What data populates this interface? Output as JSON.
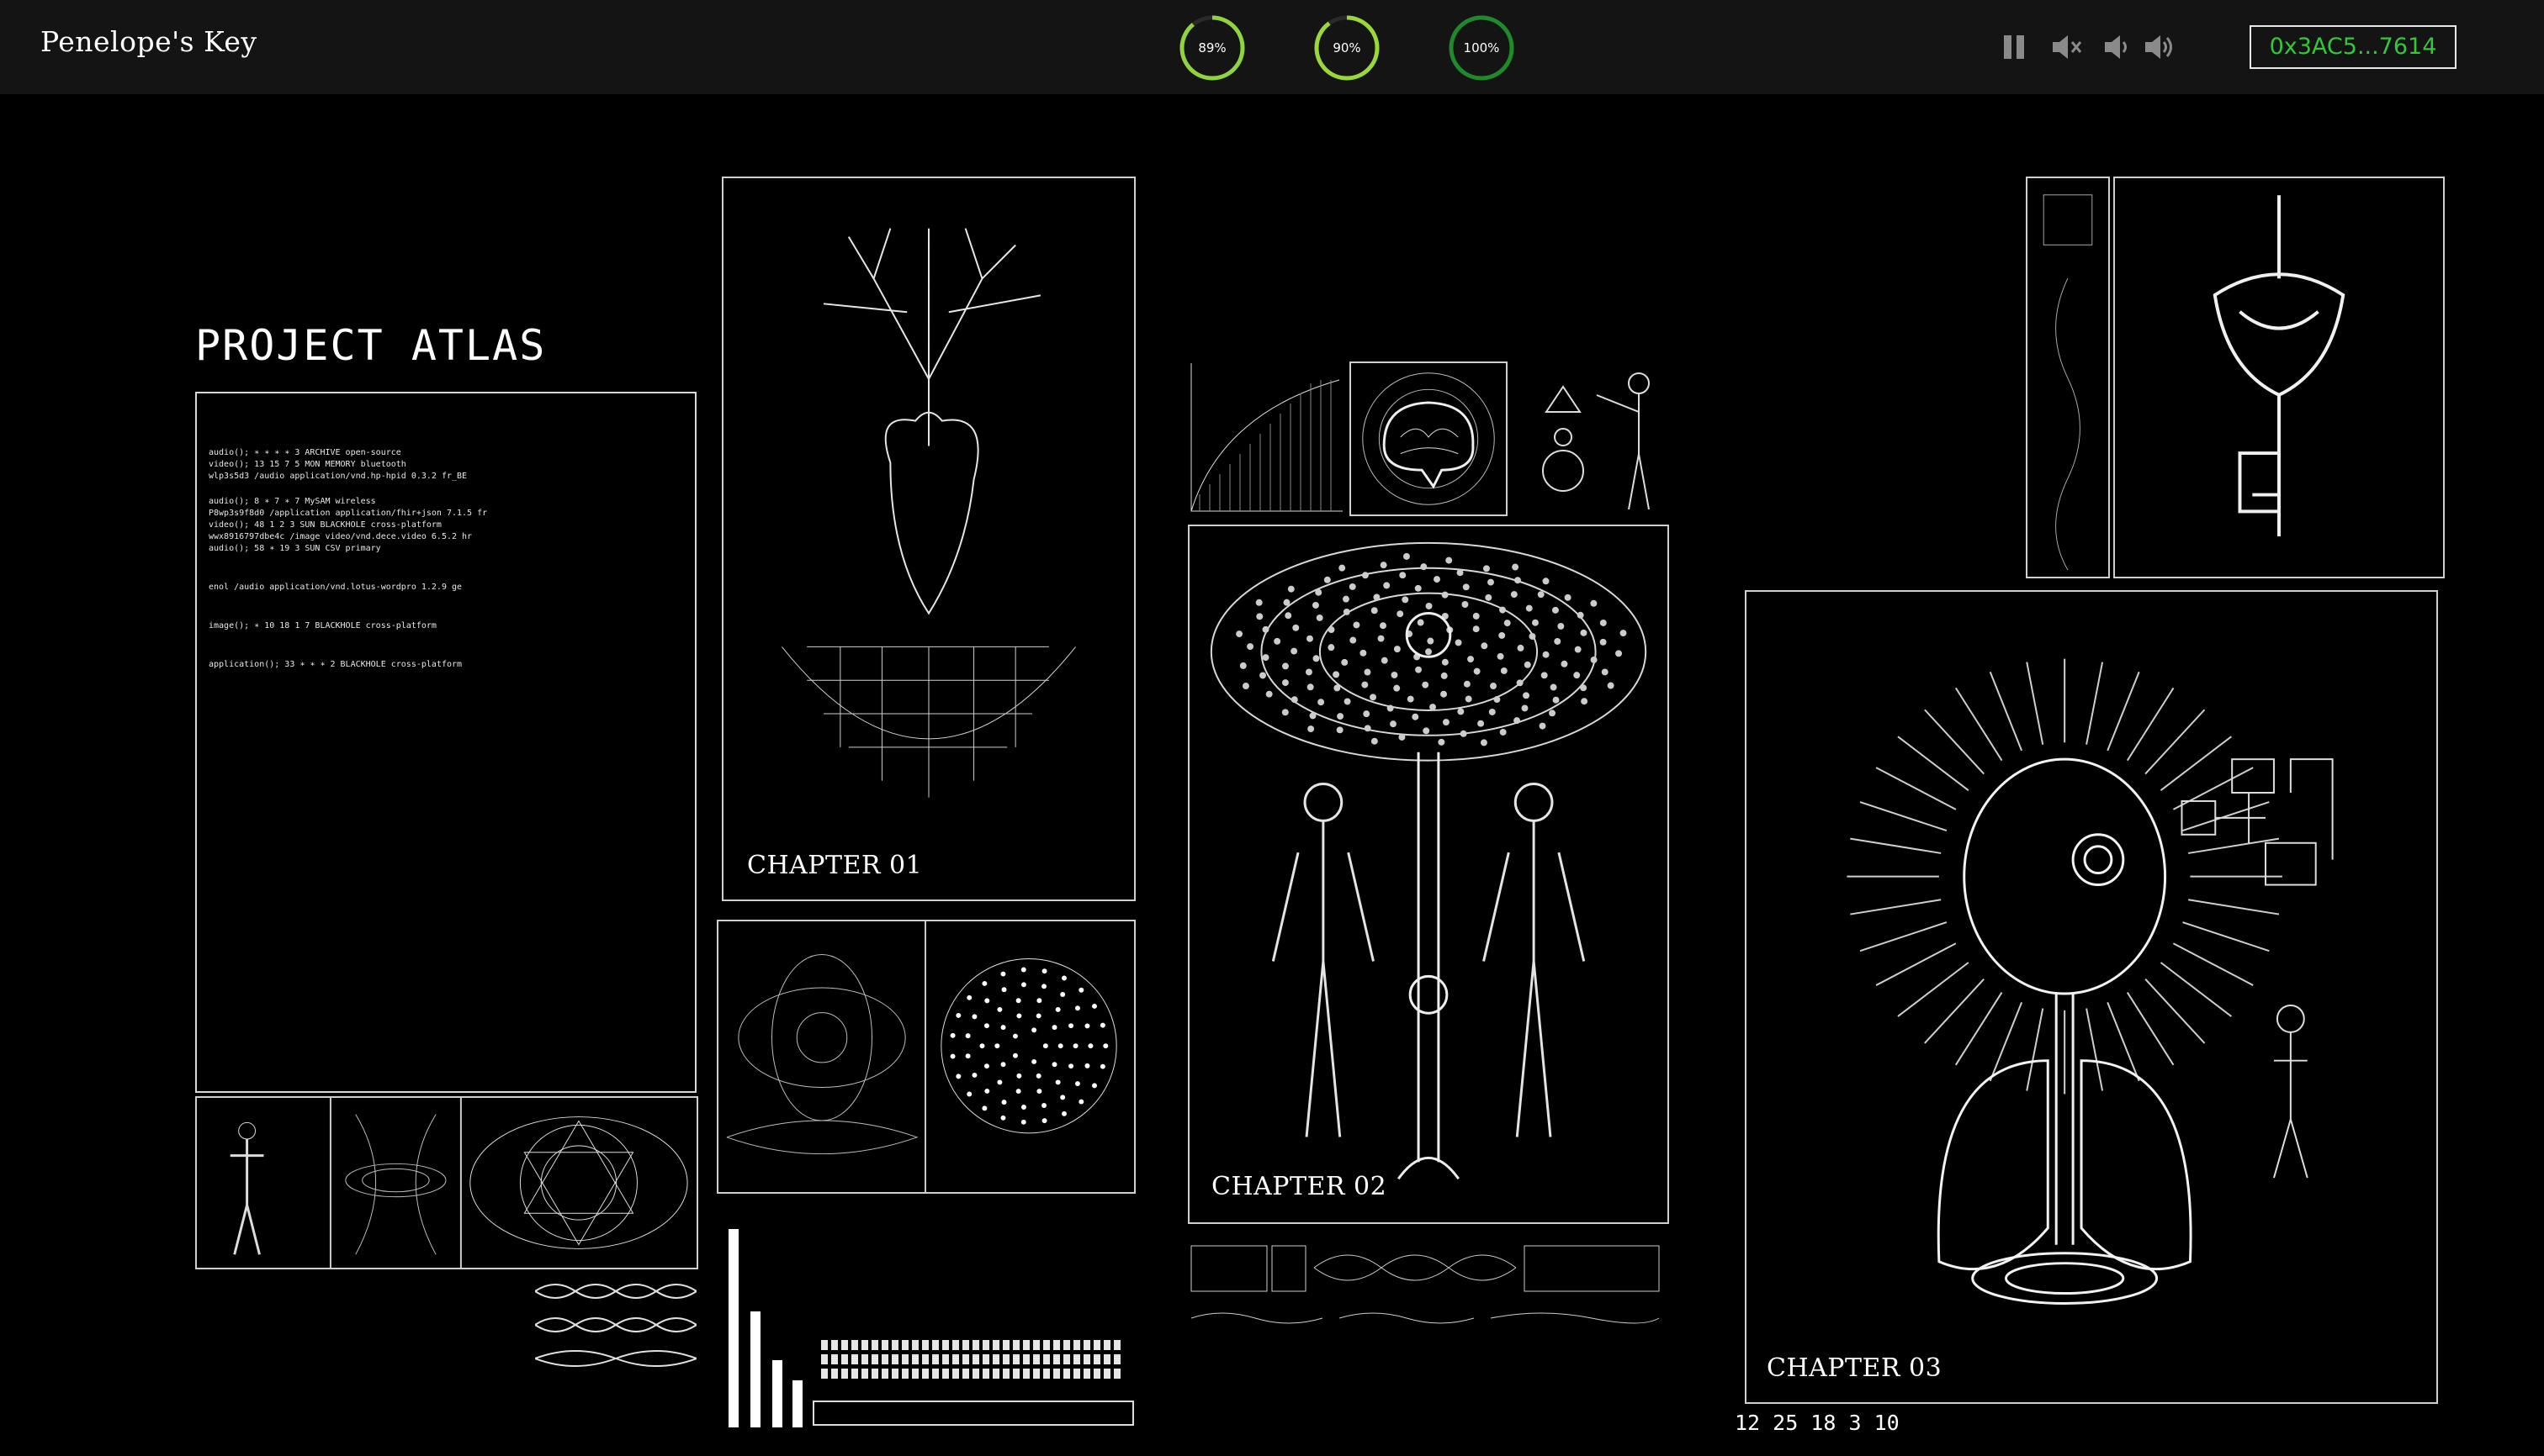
{
  "header": {
    "brand": "Penelope's Key",
    "progress": [
      {
        "label": "89%",
        "value": 0.89,
        "color": "#8fd43c"
      },
      {
        "label": "90%",
        "value": 0.9,
        "color": "#9ad83a"
      },
      {
        "label": "100%",
        "value": 1.0,
        "color": "#1f8a2a"
      }
    ],
    "controls": [
      "pause-icon",
      "mute-icon",
      "volume-low-icon",
      "volume-high-icon"
    ],
    "wallet": "0x3AC5...7614"
  },
  "main": {
    "title": "PROJECT ATLAS",
    "terminal_lines": [
      "audio(); ∗ ∗ ∗ ∗ 3 ARCHIVE open-source",
      "video(); 13 15 7 5 MON MEMORY bluetooth",
      "wlp3s5d3 /audio application/vnd.hp-hpid 0.3.2 fr_BE",
      "",
      "audio(); 8 ∗ 7 ∗ 7 MySAM wireless",
      "P8wp3s9f8d0 /application application/fhir+json 7.1.5 fr",
      "video(); 48 1 2 3 SUN BLACKHOLE cross-platform",
      "wwx8916797dbe4c /image video/vnd.dece.video 6.5.2 hr",
      "audio(); 58 ∗ 19 3 SUN CSV primary",
      "",
      "",
      "enol /audio application/vnd.lotus-wordpro 1.2.9 ge",
      "",
      "",
      "image(); ∗ 10 18 1 7 BLACKHOLE cross-platform",
      "",
      "",
      "application(); 33 ∗ ∗ ∗ 2 BLACKHOLE cross-platform"
    ],
    "chapters": [
      "CHAPTER 01",
      "CHAPTER 02",
      "CHAPTER 03"
    ],
    "numbers": "12 25 18 3 10"
  }
}
